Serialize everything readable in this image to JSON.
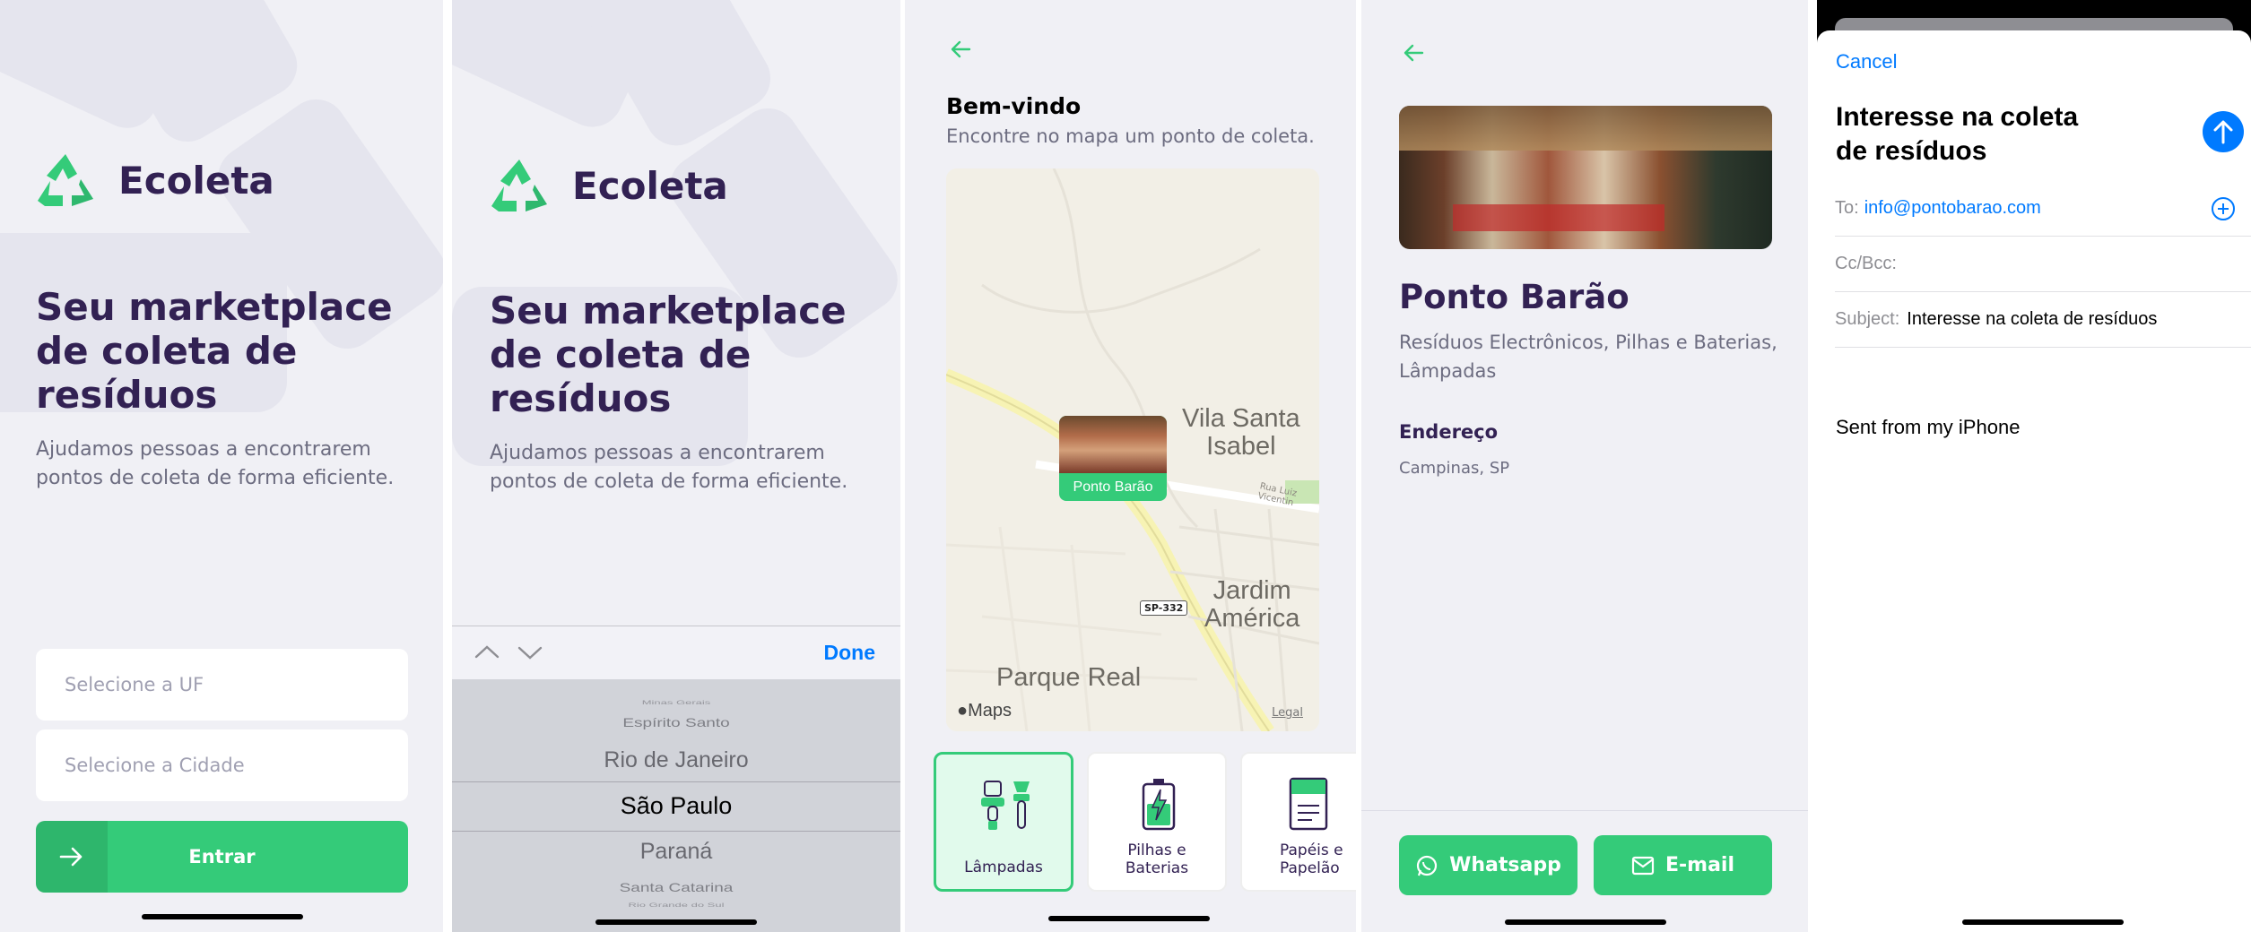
{
  "colors": {
    "primary": "#34cb79",
    "title": "#322153",
    "text": "#6c6c80",
    "ios_blue": "#007aff"
  },
  "screen1": {
    "app_name": "Ecoleta",
    "headline": [
      "Seu marketplace",
      "de coleta de",
      "resíduos"
    ],
    "description": [
      "Ajudamos pessoas a encontrarem",
      "pontos de coleta de forma eficiente."
    ],
    "uf_placeholder": "Selecione a UF",
    "city_placeholder": "Selecione a Cidade",
    "enter_label": "Entrar",
    "icons": [
      "recycle-icon",
      "arrow-right-icon"
    ]
  },
  "screen2": {
    "app_name": "Ecoleta",
    "headline": [
      "Seu marketplace",
      "de coleta de",
      "resíduos"
    ],
    "description": [
      "Ajudamos pessoas a encontrarem",
      "pontos de coleta de forma eficiente."
    ],
    "done_label": "Done",
    "picker_items": [
      "Minas Gerais",
      "Espírito Santo",
      "Rio de Janeiro",
      "São Paulo",
      "Paraná",
      "Santa Catarina",
      "Rio Grande do Sul"
    ],
    "selected": "São Paulo"
  },
  "screen3": {
    "title": "Bem-vindo",
    "subtitle": "Encontre no mapa um ponto de coleta.",
    "map": {
      "labels": [
        "Vila Santa",
        "Isabel",
        "Jardim",
        "América",
        "Parque Real",
        "Rua Luiz Vicentin"
      ],
      "road_badge": "SP-332",
      "brand": "Maps",
      "legal": "Legal",
      "pin_label": "Ponto Barão"
    },
    "items": [
      {
        "label": [
          "Lâmpadas"
        ],
        "selected": true
      },
      {
        "label": [
          "Pilhas e",
          "Baterias"
        ],
        "selected": false
      },
      {
        "label": [
          "Papéis e",
          "Papelão"
        ],
        "selected": false
      }
    ]
  },
  "screen4": {
    "name": "Ponto Barão",
    "items_text": [
      "Resíduos Electrônicos, Pilhas e Baterias,",
      "Lâmpadas"
    ],
    "address_title": "Endereço",
    "address": "Campinas, SP",
    "whatsapp_label": "Whatsapp",
    "email_label": "E-mail"
  },
  "screen5": {
    "cancel": "Cancel",
    "subject_title": [
      "Interesse na coleta",
      "de resíduos"
    ],
    "to_label": "To:",
    "to_value": "info@pontobarao.com",
    "cc_label": "Cc/Bcc:",
    "subject_label": "Subject:",
    "subject_value": "Interesse na coleta de resíduos",
    "body": "Sent from my iPhone"
  }
}
